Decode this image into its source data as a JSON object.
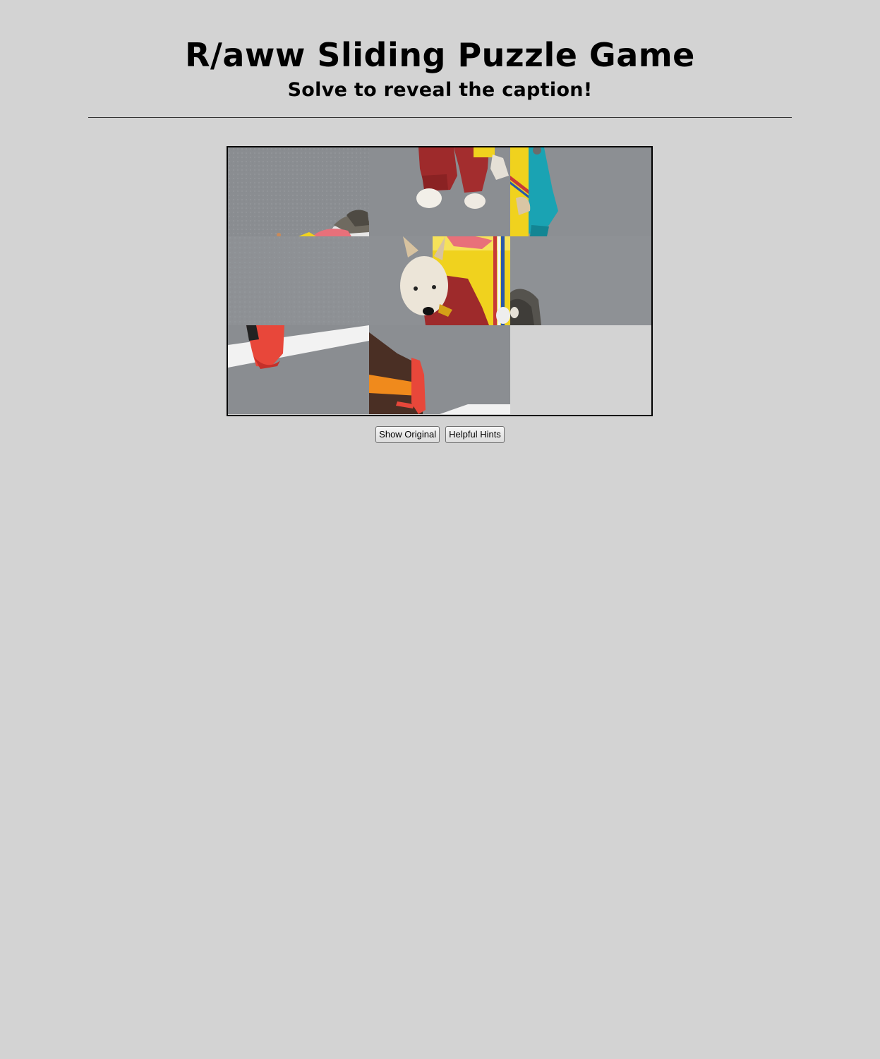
{
  "header": {
    "title": "R/aww Sliding Puzzle Game",
    "subtitle": "Solve to reveal the caption!"
  },
  "puzzle": {
    "grid": {
      "rows": 3,
      "cols": 3
    },
    "tiles": [
      {
        "piece": "road-gift-bow-tile"
      },
      {
        "piece": "red-outfit-legs-tile"
      },
      {
        "piece": "gift-box-teal-legs-tile"
      },
      {
        "piece": "plain-asphalt-tile"
      },
      {
        "piece": "dog-face-gift-box-tile"
      },
      {
        "piece": "asphalt-gray-paw-tile"
      },
      {
        "piece": "red-sneaker-crosswalk-tile"
      },
      {
        "piece": "orange-striped-shoe-tile"
      },
      {
        "piece": "empty-slot"
      }
    ],
    "colors": {
      "asphalt": "#8d9094",
      "crosswalk": "#f2f2f2",
      "outfit_red": "#9e2a2b",
      "gift_yellow": "#f0d21e",
      "teal": "#1aa3b3",
      "sneaker_red": "#e8473a",
      "shoe_orange": "#f08a1c"
    }
  },
  "controls": {
    "show_original_label": "Show Original",
    "helpful_hints_label": "Helpful Hints"
  }
}
